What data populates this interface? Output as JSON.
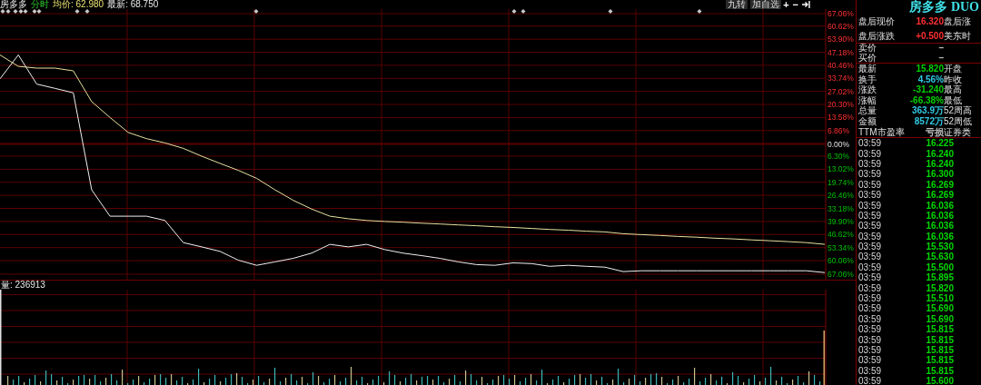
{
  "header": {
    "stock": "房多多",
    "mode": "分时",
    "average": "均价: 62.980",
    "latest": "最新: 68.750"
  },
  "toolbar": {
    "buttons": [
      "九转",
      "加自选"
    ],
    "zoom_in": "+",
    "zoom_out": "−"
  },
  "chart": {
    "chart_data": {
      "type": "line",
      "ylim": [
        -67.06,
        67.06
      ],
      "grid": true,
      "yticks": [
        {
          "value": 67.06,
          "label": "67.06%"
        },
        {
          "value": 60.62,
          "label": "60.62%"
        },
        {
          "value": 53.9,
          "label": "53.90%"
        },
        {
          "value": 47.18,
          "label": "47.18%"
        },
        {
          "value": 40.46,
          "label": "40.46%"
        },
        {
          "value": 33.74,
          "label": "33.74%"
        },
        {
          "value": 27.02,
          "label": "27.02%"
        },
        {
          "value": 20.3,
          "label": "20.30%"
        },
        {
          "value": 13.58,
          "label": "13.58%"
        },
        {
          "value": 6.86,
          "label": "6.86%"
        },
        {
          "value": 0,
          "label": "0.00%"
        },
        {
          "value": -6.3,
          "label": "6.30%"
        },
        {
          "value": -13.02,
          "label": "13.02%"
        },
        {
          "value": -19.74,
          "label": "19.74%"
        },
        {
          "value": -26.46,
          "label": "26.46%"
        },
        {
          "value": -33.18,
          "label": "33.18%"
        },
        {
          "value": -39.9,
          "label": "39.90%"
        },
        {
          "value": -46.62,
          "label": "46.62%"
        },
        {
          "value": -53.34,
          "label": "53.34%"
        },
        {
          "value": -60.06,
          "label": "60.06%"
        },
        {
          "value": -67.06,
          "label": "67.06%"
        }
      ],
      "series": [
        {
          "color": "#f0f0f0",
          "values": [
            33.5,
            45.8,
            30.8,
            28.6,
            26.3,
            -23.6,
            -37.2,
            -37.2,
            -37.2,
            -39.4,
            -50.8,
            -53,
            -55.3,
            -59.8,
            -62.5,
            -60.7,
            -58.9,
            -56.2,
            -51.7,
            -53,
            -51.7,
            -54.4,
            -56.2,
            -57.5,
            -58.9,
            -60.7,
            -62.1,
            -62.5,
            -61.2,
            -61.6,
            -63,
            -62.5,
            -63,
            -63.4,
            -65.7,
            -65.3,
            -65.3,
            -65.3,
            -65.3,
            -65.3,
            -65.3,
            -65.3,
            -65.3,
            -65.3,
            -65.3,
            -66.2
          ]
        },
        {
          "color": "#e8e0a0",
          "values": [
            45.8,
            39.9,
            39,
            39,
            37.6,
            21.8,
            13.6,
            5.9,
            2.7,
            0.5,
            -2.3,
            -6.3,
            -10,
            -13.6,
            -17.7,
            -23.6,
            -29,
            -33.5,
            -37.2,
            -38.5,
            -39.4,
            -39.9,
            -40.3,
            -40.8,
            -41.2,
            -41.7,
            -42.1,
            -42.6,
            -43,
            -43.5,
            -44,
            -44.4,
            -44.9,
            -45.3,
            -46.2,
            -46.7,
            -47.1,
            -47.6,
            -48,
            -48.5,
            -48.9,
            -49.4,
            -49.8,
            -50.3,
            -50.8,
            -51.7
          ]
        }
      ]
    }
  },
  "volume": {
    "label": "量: 236913"
  },
  "quote": {
    "title": "房多多 DUO",
    "groups": [
      {
        "rows": [
          {
            "label": "盘后现价",
            "value": "16.320",
            "color": "#ff3030",
            "label_2": "盘后涨"
          },
          {
            "label": "盘后涨跌",
            "value": "+0.500",
            "color": "#ff3030",
            "label_2": "美东时"
          }
        ]
      },
      {
        "rows": [
          {
            "label": "卖价",
            "value": "–",
            "color": "#c0c0c0"
          },
          {
            "label": "买价",
            "value": "–",
            "color": "#c0c0c0"
          }
        ]
      },
      {
        "rows": [
          {
            "label": "最新",
            "value": "15.820",
            "color": "#00d000",
            "label_2": "开盘"
          },
          {
            "label": "换手",
            "value": "4.56%",
            "color": "#30c8e0",
            "label_2": "昨收"
          },
          {
            "label": "涨跌",
            "value": "-31.240",
            "color": "#00d000",
            "label_2": "最高"
          },
          {
            "label": "涨幅",
            "value": "-66.38%",
            "color": "#00d000",
            "label_2": "最低"
          },
          {
            "label": "总量",
            "value": "363.9万",
            "color": "#30c8e0",
            "label_2": "52周高"
          },
          {
            "label": "金额",
            "value": "8572万",
            "color": "#30c8e0",
            "label_2": "52周低"
          },
          {
            "label": "TTM市盈率",
            "value": "亏损",
            "color": "#c0c0c0",
            "label_2": "证券类"
          }
        ]
      }
    ]
  },
  "ticks": [
    {
      "time": "03:59",
      "price": "16.225"
    },
    {
      "time": "03:59",
      "price": "16.240"
    },
    {
      "time": "03:59",
      "price": "16.240"
    },
    {
      "time": "03:59",
      "price": "16.300"
    },
    {
      "time": "03:59",
      "price": "16.269"
    },
    {
      "time": "03:59",
      "price": "16.269"
    },
    {
      "time": "03:59",
      "price": "16.036"
    },
    {
      "time": "03:59",
      "price": "16.036"
    },
    {
      "time": "03:59",
      "price": "16.036"
    },
    {
      "time": "03:59",
      "price": "16.036"
    },
    {
      "time": "03:59",
      "price": "15.530"
    },
    {
      "time": "03:59",
      "price": "15.630"
    },
    {
      "time": "03:59",
      "price": "15.500"
    },
    {
      "time": "03:59",
      "price": "15.895"
    },
    {
      "time": "03:59",
      "price": "15.820"
    },
    {
      "time": "03:59",
      "price": "15.510"
    },
    {
      "time": "03:59",
      "price": "15.690"
    },
    {
      "time": "03:59",
      "price": "15.690"
    },
    {
      "time": "03:59",
      "price": "15.815"
    },
    {
      "time": "03:59",
      "price": "15.815"
    },
    {
      "time": "03:59",
      "price": "15.815"
    },
    {
      "time": "03:59",
      "price": "15.815"
    },
    {
      "time": "03:59",
      "price": "15.815"
    },
    {
      "time": "03:59",
      "price": "15.600"
    }
  ]
}
